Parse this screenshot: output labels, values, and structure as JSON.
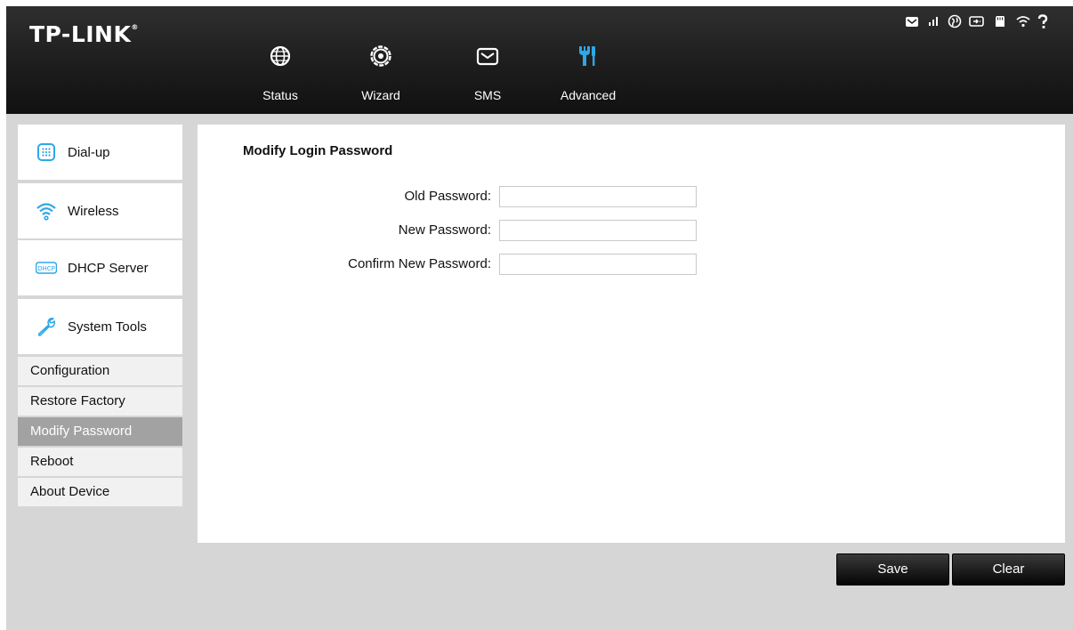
{
  "header": {
    "brand": "TP-LINK",
    "brand_mark": "®",
    "nav": [
      {
        "label": "Status",
        "icon": "globe-icon"
      },
      {
        "label": "Wizard",
        "icon": "gear-icon"
      },
      {
        "label": "SMS",
        "icon": "envelope-icon"
      },
      {
        "label": "Advanced",
        "icon": "tools-icon"
      }
    ],
    "active_nav_color": "#2ea7e8",
    "status_icons": [
      "message-icon",
      "signal-icon",
      "internet-icon",
      "battery-icon",
      "sd-card-icon",
      "wifi-icon",
      "help-icon"
    ]
  },
  "sidebar": {
    "sections": [
      {
        "label": "Dial-up",
        "icon": "keypad-icon"
      },
      {
        "label": "Wireless",
        "icon": "wifi-icon"
      },
      {
        "label": "DHCP Server",
        "icon": "dhcp-icon"
      },
      {
        "label": "System Tools",
        "icon": "wrench-icon"
      }
    ],
    "sub_items": [
      {
        "label": "Configuration"
      },
      {
        "label": "Restore Factory"
      },
      {
        "label": "Modify Password",
        "active": true
      },
      {
        "label": "Reboot"
      },
      {
        "label": "About Device"
      }
    ],
    "accent": "#2ea7e8"
  },
  "main": {
    "title": "Modify Login Password",
    "fields": [
      {
        "label": "Old Password:",
        "value": ""
      },
      {
        "label": "New Password:",
        "value": ""
      },
      {
        "label": "Confirm New Password:",
        "value": ""
      }
    ]
  },
  "actions": {
    "save": "Save",
    "clear": "Clear"
  }
}
